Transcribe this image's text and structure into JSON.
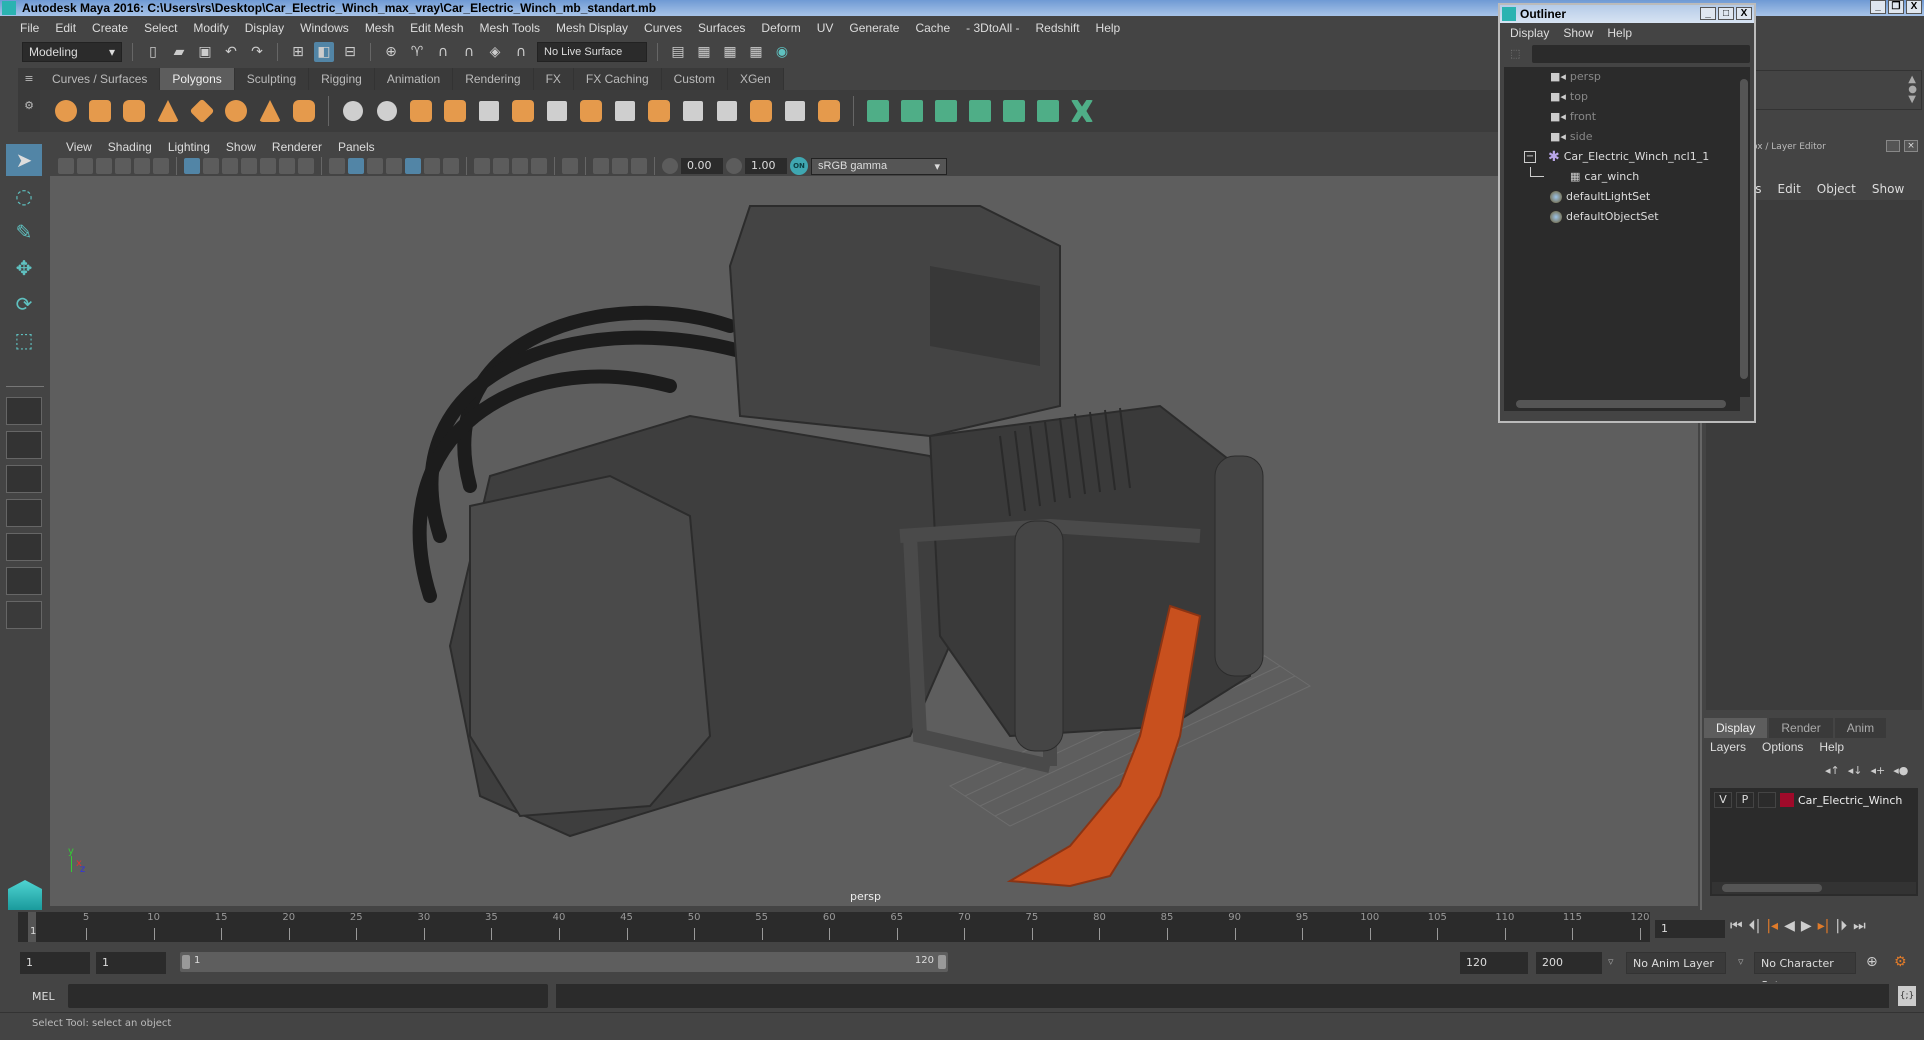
{
  "window": {
    "title": "Autodesk Maya 2016: C:\\Users\\rs\\Desktop\\Car_Electric_Winch_max_vray\\Car_Electric_Winch_mb_standart.mb",
    "buttons": [
      "_",
      "❐",
      "X"
    ]
  },
  "menubar": [
    "File",
    "Edit",
    "Create",
    "Select",
    "Modify",
    "Display",
    "Windows",
    "Mesh",
    "Edit Mesh",
    "Mesh Tools",
    "Mesh Display",
    "Curves",
    "Surfaces",
    "Deform",
    "UV",
    "Generate",
    "Cache",
    "- 3DtoAll -",
    "Redshift",
    "Help"
  ],
  "statusline": {
    "mode": "Modeling",
    "live_surface": "No Live Surface"
  },
  "shelf": {
    "tabs": [
      "Curves / Surfaces",
      "Polygons",
      "Sculpting",
      "Rigging",
      "Animation",
      "Rendering",
      "FX",
      "FX Caching",
      "Custom",
      "XGen"
    ],
    "active_tab": "Polygons"
  },
  "viewport": {
    "menu": [
      "View",
      "Shading",
      "Lighting",
      "Show",
      "Renderer",
      "Panels"
    ],
    "exposure": "0.00",
    "gamma": "1.00",
    "color_mgmt_toggle": "ON",
    "view_transform": "sRGB gamma",
    "camera_label": "persp",
    "axis": {
      "y": "y",
      "x": "x",
      "z": "z"
    },
    "colors": {
      "background": "#5e5e5e",
      "model": "#3d3d3d",
      "strap": "#c8501e"
    }
  },
  "outliner": {
    "title": "Outliner",
    "menu": [
      "Display",
      "Show",
      "Help"
    ],
    "items": [
      {
        "label": "persp",
        "type": "camera",
        "dim": true
      },
      {
        "label": "top",
        "type": "camera",
        "dim": true
      },
      {
        "label": "front",
        "type": "camera",
        "dim": true
      },
      {
        "label": "side",
        "type": "camera",
        "dim": true
      },
      {
        "label": "Car_Electric_Winch_ncl1_1",
        "type": "group",
        "expanded": true
      },
      {
        "label": "car_winch",
        "type": "mesh",
        "child": true
      },
      {
        "label": "defaultLightSet",
        "type": "set"
      },
      {
        "label": "defaultObjectSet",
        "type": "set"
      }
    ]
  },
  "channelbox": {
    "title": "Channel Box / Layer Editor",
    "menu": [
      "Channels",
      "Edit",
      "Object",
      "Show"
    ],
    "layer_tabs": [
      "Display",
      "Render",
      "Anim"
    ],
    "active_layer_tab": "Display",
    "layer_menu": [
      "Layers",
      "Options",
      "Help"
    ],
    "layers": [
      {
        "v": "V",
        "p": "P",
        "color": "#a00a2a",
        "name": "Car_Electric_Winch"
      }
    ]
  },
  "timeslider": {
    "ticks": [
      5,
      10,
      15,
      20,
      25,
      30,
      35,
      40,
      45,
      50,
      55,
      60,
      65,
      70,
      75,
      80,
      85,
      90,
      95,
      100,
      105,
      110,
      115,
      120
    ],
    "start": 1,
    "end": 120,
    "current_frame_marker": "1",
    "current_frame": "1"
  },
  "rangeslider": {
    "start_time": "1",
    "playback_start": "1",
    "range_start_label": "1",
    "range_end_label": "120",
    "playback_end": "120",
    "end_time": "200",
    "anim_layer": "No Anim Layer",
    "character_set": "No Character Set"
  },
  "cmdline": {
    "label": "MEL"
  },
  "helpline": {
    "text": "Select Tool: select an object"
  }
}
